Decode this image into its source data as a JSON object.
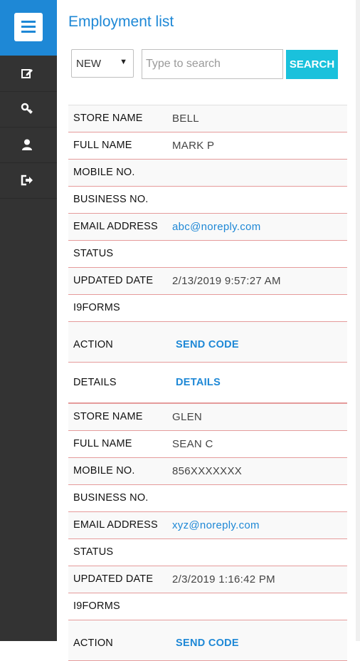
{
  "header": {
    "title": "Employment list"
  },
  "sidebar": {
    "items": [
      {
        "icon": "edit-icon"
      },
      {
        "icon": "key-icon"
      },
      {
        "icon": "user-icon"
      },
      {
        "icon": "logout-icon"
      }
    ]
  },
  "filters": {
    "status_value": "NEW",
    "search_placeholder": "Type to search",
    "search_label": "SEARCH"
  },
  "labels": {
    "store_name": "STORE NAME",
    "full_name": "FULL NAME",
    "mobile_no": "MOBILE NO.",
    "business_no": "BUSINESS NO.",
    "email_address": "EMAIL ADDRESS",
    "status": "STATUS",
    "updated_date": "UPDATED DATE",
    "i9forms": "I9FORMS",
    "action": "ACTION",
    "details": "DETAILS"
  },
  "records": [
    {
      "store_name": "BELL",
      "full_name": "MARK P",
      "mobile_no": "",
      "business_no": "",
      "email": "abc@noreply.com",
      "status": "",
      "updated_date": "2/13/2019 9:57:27 AM",
      "i9forms": "",
      "action_link": "SEND CODE",
      "details_link": "DETAILS"
    },
    {
      "store_name": "GLEN",
      "full_name": "SEAN C",
      "mobile_no": "856XXXXXXX",
      "business_no": "",
      "email": "xyz@noreply.com",
      "status": "",
      "updated_date": "2/3/2019 1:16:42 PM",
      "i9forms": "",
      "action_link": "SEND CODE"
    }
  ]
}
